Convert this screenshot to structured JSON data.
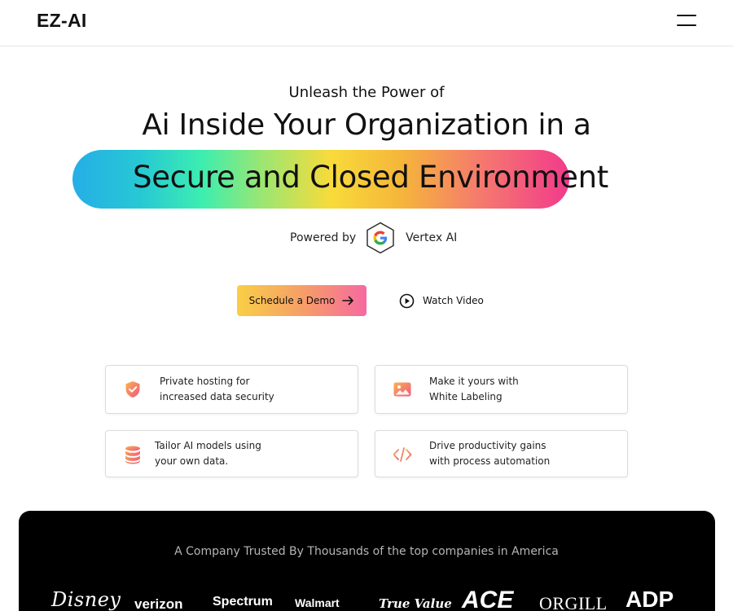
{
  "header": {
    "logo": "EZ-AI",
    "menu_icon": "hamburger-menu-icon"
  },
  "hero": {
    "eyebrow": "Unleash the Power of",
    "headline": "Ai Inside Your Organization in a",
    "highlight": "Secure and Closed Environment",
    "powered_by_label": "Powered by",
    "powered_by_icon": "google-cloud-hexagon-icon",
    "powered_by_product": "Vertex AI"
  },
  "actions": {
    "primary_label": "Schedule a Demo",
    "primary_icon": "arrow-right-icon",
    "secondary_label": "Watch Video",
    "secondary_icon": "play-circle-icon"
  },
  "features": [
    {
      "icon": "shield-check-icon",
      "line1": "Private hosting for",
      "line2": "increased data security"
    },
    {
      "icon": "image-icon",
      "line1": "Make it yours with",
      "line2": "White Labeling"
    },
    {
      "icon": "database-icon",
      "line1": "Tailor AI models using",
      "line2": "your own data."
    },
    {
      "icon": "code-icon",
      "line1": "Drive productivity gains",
      "line2": "with process automation"
    }
  ],
  "trust": {
    "heading": "A Company Trusted By Thousands of the top companies in America",
    "logos": [
      "Disney",
      "verizon",
      "Spectrum",
      "Walmart",
      "True Value",
      "ACE",
      "ORGILL",
      "ADP"
    ]
  },
  "colors": {
    "accent_start": "#f8cf46",
    "accent_end": "#f66aa0",
    "icon_gradient_start": "#f8a35a",
    "icon_gradient_end": "#f0567f",
    "trust_band_bg": "#000000"
  }
}
